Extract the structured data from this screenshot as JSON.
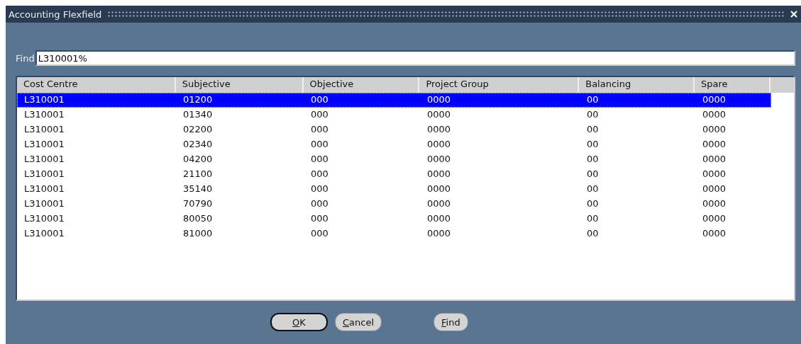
{
  "window": {
    "title": "Accounting Flexfield"
  },
  "find": {
    "label": "Find",
    "value": "L310001%"
  },
  "table": {
    "columns": [
      "Cost Centre",
      "Subjective",
      "Objective",
      "Project Group",
      "Balancing",
      "Spare"
    ],
    "rows": [
      {
        "cells": [
          "L310001",
          "01200",
          "000",
          "0000",
          "00",
          "0000"
        ],
        "selected": true
      },
      {
        "cells": [
          "L310001",
          "01340",
          "000",
          "0000",
          "00",
          "0000"
        ],
        "selected": false
      },
      {
        "cells": [
          "L310001",
          "02200",
          "000",
          "0000",
          "00",
          "0000"
        ],
        "selected": false
      },
      {
        "cells": [
          "L310001",
          "02340",
          "000",
          "0000",
          "00",
          "0000"
        ],
        "selected": false
      },
      {
        "cells": [
          "L310001",
          "04200",
          "000",
          "0000",
          "00",
          "0000"
        ],
        "selected": false
      },
      {
        "cells": [
          "L310001",
          "21100",
          "000",
          "0000",
          "00",
          "0000"
        ],
        "selected": false
      },
      {
        "cells": [
          "L310001",
          "35140",
          "000",
          "0000",
          "00",
          "0000"
        ],
        "selected": false
      },
      {
        "cells": [
          "L310001",
          "70790",
          "000",
          "0000",
          "00",
          "0000"
        ],
        "selected": false
      },
      {
        "cells": [
          "L310001",
          "80050",
          "000",
          "0000",
          "00",
          "0000"
        ],
        "selected": false
      },
      {
        "cells": [
          "L310001",
          "81000",
          "000",
          "0000",
          "00",
          "0000"
        ],
        "selected": false
      }
    ]
  },
  "buttons": [
    {
      "label": "OK",
      "default": true
    },
    {
      "label": "Cancel",
      "default": false
    },
    {
      "label": "Find",
      "default": false
    }
  ]
}
